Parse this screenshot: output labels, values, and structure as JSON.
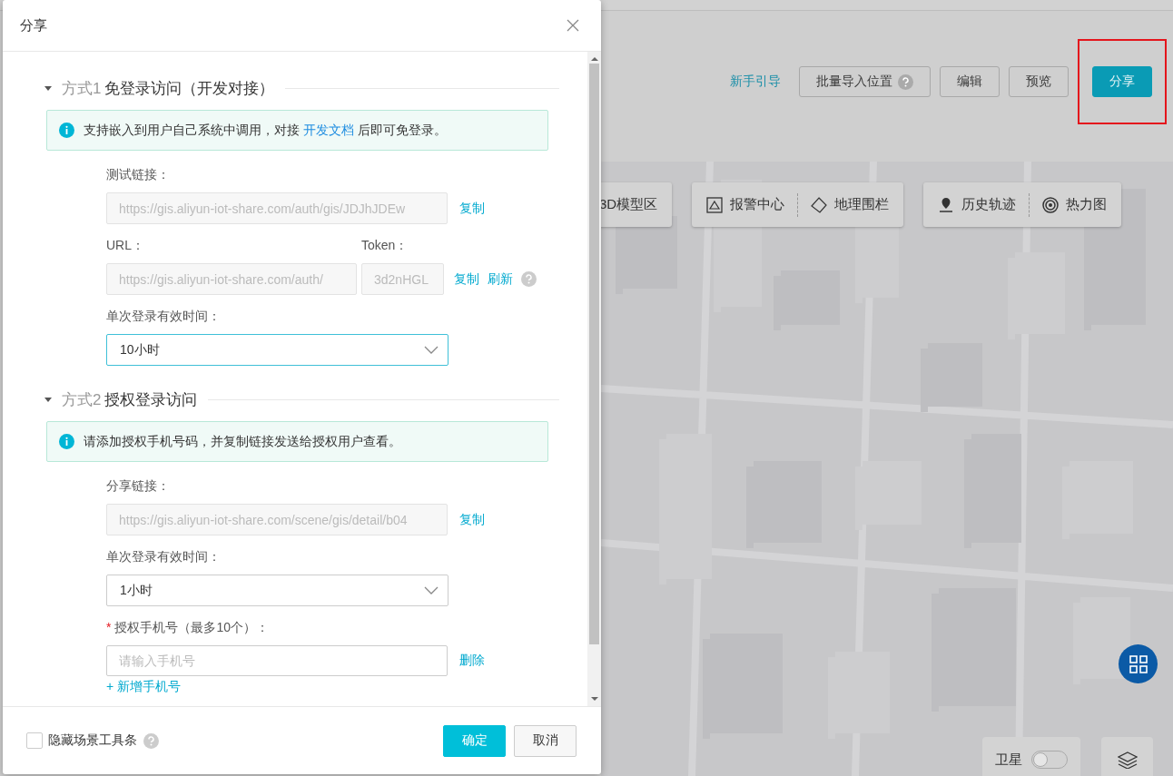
{
  "page": {
    "guide_link": "新手引导",
    "header_buttons": [
      {
        "label": "批量导入位置",
        "help": true,
        "primary": false,
        "highlighted": false
      },
      {
        "label": "编辑",
        "help": false,
        "primary": false,
        "highlighted": false
      },
      {
        "label": "预览",
        "help": false,
        "primary": false,
        "highlighted": false
      },
      {
        "label": "分享",
        "help": false,
        "primary": true,
        "highlighted": true
      }
    ],
    "map_toolbars": [
      [
        {
          "label": "3D模型区",
          "kind": "plain"
        }
      ],
      [
        {
          "label": "报警中心",
          "kind": "alarm"
        },
        {
          "label": "地理围栏",
          "kind": "fence"
        }
      ],
      [
        {
          "label": "历史轨迹",
          "kind": "track"
        },
        {
          "label": "热力图",
          "kind": "heat"
        }
      ]
    ],
    "map": {
      "kind": "picture"
    },
    "satellite": {
      "label": "卫星",
      "on": false
    }
  },
  "dialog": {
    "title": "分享",
    "sections": [
      {
        "prefix": "方式1",
        "title": "免登录访问（开发对接）",
        "expanded": true,
        "notice": {
          "before": "支持嵌入到用户自己系统中调用，对接 ",
          "link": "开发文档",
          "after": " 后即可免登录。"
        },
        "fields": [
          {
            "kind": "readonly",
            "label": "测试链接：",
            "value": "https://gis.aliyun-iot-share.com/auth/gis/JDJhJDEw",
            "actions": [
              "复制"
            ]
          },
          {
            "kind": "pair",
            "labels": [
              "URL：",
              "Token："
            ],
            "values": [
              "https://gis.aliyun-iot-share.com/auth/",
              "3d2nHGL"
            ],
            "actions": [
              "复制",
              "刷新"
            ],
            "help": true
          },
          {
            "kind": "select",
            "label": "单次登录有效时间：",
            "value": "10小时",
            "focused": true
          }
        ]
      },
      {
        "prefix": "方式2",
        "title": "授权登录访问",
        "expanded": true,
        "notice": {
          "before": "请添加授权手机号码，并复制链接发送给授权用户查看。"
        },
        "fields": [
          {
            "kind": "readonly",
            "label": "分享链接：",
            "value": "https://gis.aliyun-iot-share.com/scene/gis/detail/b04",
            "actions": [
              "复制"
            ]
          },
          {
            "kind": "select",
            "label": "单次登录有效时间：",
            "value": "1小时",
            "focused": false
          },
          {
            "kind": "input",
            "label": "授权手机号（最多10个）：",
            "required_mark": "*",
            "placeholder": "请输入手机号",
            "actions": [
              "删除"
            ]
          },
          {
            "kind": "add",
            "label": "+ 新增手机号"
          }
        ]
      }
    ],
    "footer": {
      "checkbox": {
        "label": "隐藏场景工具条",
        "checked": false,
        "help": true
      },
      "buttons": [
        {
          "label": "确定",
          "primary": true
        },
        {
          "label": "取消",
          "primary": false
        }
      ]
    }
  }
}
